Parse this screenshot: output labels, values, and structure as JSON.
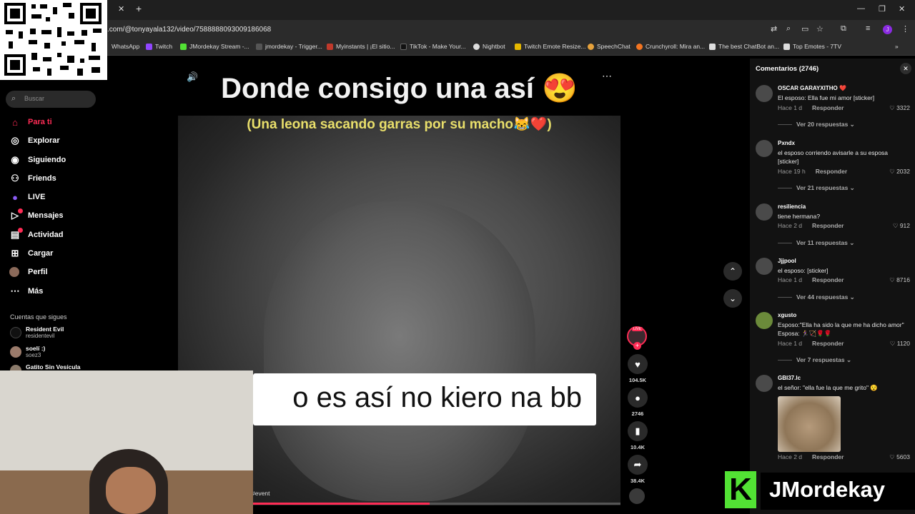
{
  "browser": {
    "url": ".com/@tonyayala132/video/7588888093009186068",
    "bookmarks": [
      "WhatsApp",
      "Twitch",
      "JMordekay Stream -...",
      "jmordekay - Trigger...",
      "Myinstants | ¡El sitio...",
      "TikTok - Make Your...",
      "Nightbot",
      "Twitch Emote Resize...",
      "SpeechChat",
      "Crunchyroll: Mira an...",
      "The best ChatBot an...",
      "Top Emotes - 7TV"
    ],
    "profile_initial": "J"
  },
  "sidebar": {
    "search_placeholder": "Buscar",
    "nav": [
      {
        "label": "Para ti",
        "icon": "home-icon"
      },
      {
        "label": "Explorar",
        "icon": "compass-icon"
      },
      {
        "label": "Siguiendo",
        "icon": "following-icon"
      },
      {
        "label": "Friends",
        "icon": "friends-icon"
      },
      {
        "label": "LIVE",
        "icon": "live-icon"
      },
      {
        "label": "Mensajes",
        "icon": "messages-icon"
      },
      {
        "label": "Actividad",
        "icon": "activity-icon"
      },
      {
        "label": "Cargar",
        "icon": "upload-icon"
      },
      {
        "label": "Perfil",
        "icon": "profile-icon"
      },
      {
        "label": "Más",
        "icon": "more-icon"
      }
    ],
    "following_title": "Cuentas que sigues",
    "accounts": [
      {
        "name": "Resident Evil",
        "handle": "residentevil"
      },
      {
        "name": "soelí :)",
        "handle": "soez3"
      },
      {
        "name": "Gatito Sin Vesícula",
        "handle": ""
      }
    ]
  },
  "video": {
    "caption_top": "Donde consigo una así 😍",
    "caption_sub": "(Una leona sacando garras por su macho😹❤️)",
    "caption_bottom": "o es así no kiero na bb",
    "hashtag": "#event",
    "progress": 0.48
  },
  "actions": {
    "live_label": "LIVE",
    "likes": "104.5K",
    "comments": "2746",
    "saves": "10.4K",
    "shares": "38.4K"
  },
  "comments_panel": {
    "title": "Comentarios (2746)",
    "items": [
      {
        "user": "OSCAR GARAYXITHO ❤️",
        "text": "El esposo: Ella fue mi amor [sticker]",
        "time": "Hace 1 d",
        "reply": "Responder",
        "likes": "3322",
        "replies": "Ver 20 respuestas"
      },
      {
        "user": "Pxndx",
        "text": "el esposo corriendo avisarle a su esposa [sticker]",
        "time": "Hace 19 h",
        "reply": "Responder",
        "likes": "2032",
        "replies": "Ver 21 respuestas"
      },
      {
        "user": "resiliencia",
        "text": "tiene hermana?",
        "time": "Hace 2 d",
        "reply": "Responder",
        "likes": "912",
        "replies": "Ver 11 respuestas"
      },
      {
        "user": "Jjjpool",
        "text": "el esposo: [sticker]",
        "time": "Hace 1 d",
        "reply": "Responder",
        "likes": "8716",
        "replies": "Ver 44 respuestas"
      },
      {
        "user": "xgusto",
        "text": "Esposo:\"Ella ha sido la que me ha dicho amor\" Esposa: 🏃‍♀️🏹🌹🌹",
        "time": "Hace 1 d",
        "reply": "Responder",
        "likes": "1120",
        "replies": "Ver 7 respuestas"
      },
      {
        "user": "GBI37.lc",
        "text": "el señor: \"ella fue la que me grito\" 😯",
        "time": "Hace 2 d",
        "reply": "Responder",
        "likes": "5603",
        "replies": ""
      }
    ]
  },
  "overlay": {
    "brand": "JMordekay",
    "brand_letter": "K"
  }
}
